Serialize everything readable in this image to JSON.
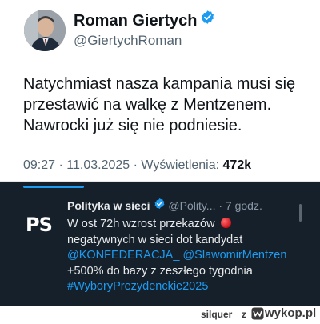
{
  "tweet1": {
    "author_name": "Roman Giertych",
    "handle": "@GiertychRoman",
    "body_lines": [
      "Natychmiast nasza kampania musi się",
      "przestawić na walkę z Mentzenem.",
      "Nawrocki już się nie podniesie."
    ],
    "time": "09:27",
    "date": "11.03.2025",
    "views_label": "Wyświetlenia:",
    "views_count": "472k",
    "verified_icon": "verified-badge-icon",
    "badge_color": "#1d9bf0"
  },
  "tweet2": {
    "logo_text": "PS",
    "author_name": "Polityka w sieci",
    "handle": "@Polity...",
    "time": "7 godz.",
    "line1": "W ost 72h wzrost przekazów",
    "line2": "negatywnych w sieci dot kandydat",
    "mention1": "@KONFEDERACJA_",
    "mention2": "@SlawomirMentzen",
    "line4": "+500% do bazy z zeszłego tygodnia",
    "hashtag": "#WyboryPrezydenckie2025",
    "background": "#15202b",
    "link_color": "#1d9bf0"
  },
  "footer": {
    "user": "silquer",
    "z": "z",
    "brand": "wykop.pl",
    "logo_icon": "wykop-logo-icon"
  }
}
